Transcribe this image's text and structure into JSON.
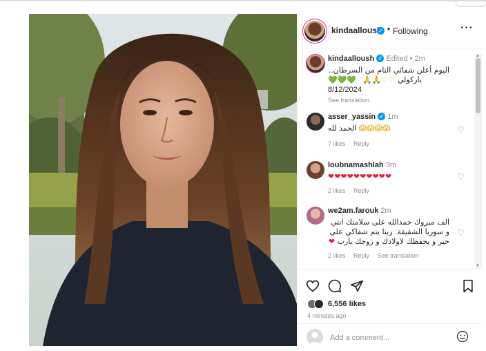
{
  "post": {
    "username": "kindaalloush",
    "follow_status": "Following",
    "more": "···"
  },
  "caption": {
    "username": "kindaalloush",
    "edited": "Edited",
    "time": "2m",
    "line1": "اليوم أعلن شفائي التام من السرطان..",
    "line2": "باركولي",
    "line2_emojis": "🙏🙏♡♡",
    "line1_emojis": "💚💚💚",
    "date": "8/12/2024",
    "see_translation": "See translation"
  },
  "comments": [
    {
      "username": "asser_yassin",
      "verified": true,
      "time": "1m",
      "text": "الحمد لله",
      "emojis": "😱😱😱😱",
      "likes": "7 likes",
      "reply": "Reply"
    },
    {
      "username": "loubnamashlah",
      "verified": false,
      "time": "3m",
      "emojis": "❤❤❤❤❤❤❤❤❤❤",
      "likes": "2 likes",
      "reply": "Reply"
    },
    {
      "username": "we2am.farouk",
      "verified": false,
      "time": "2m",
      "line1": "الف مبروك حمدالله على سلامتك انتي",
      "line2": "و سوريا الشقيقة. ربنا يتم شفاكي على",
      "line3": "خير و يحفظك لاولادك و زوجك يارب",
      "line3_emoji": "❤",
      "likes": "2 likes",
      "reply": "Reply",
      "see_translation": "See translation"
    }
  ],
  "footer": {
    "likes_count": "6,556 likes",
    "time_ago": "4 minutes ago",
    "comment_placeholder": "Add a comment..."
  },
  "icons": {
    "like": "heart-icon",
    "comment": "comment-bubble-icon",
    "share": "paper-plane-icon",
    "save": "bookmark-icon",
    "emoji": "smiley-icon"
  },
  "colors": {
    "verified": "#0095f6",
    "muted": "#8e8e8e",
    "text": "#262626",
    "border": "#dbdbdb"
  }
}
